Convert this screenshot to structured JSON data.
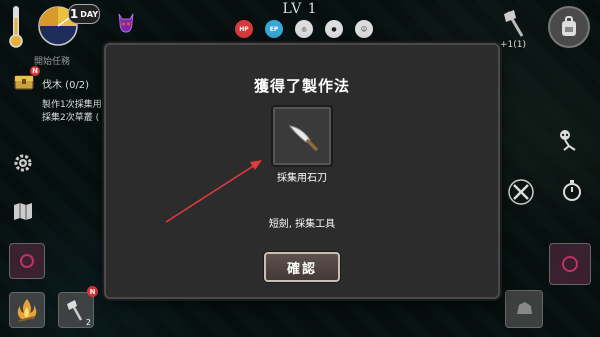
{
  "hud": {
    "day_label": "DAY",
    "day_number": "1",
    "level": "LV 1",
    "stats": [
      {
        "name": "hp",
        "label": "HP"
      },
      {
        "name": "ep",
        "label": "EP"
      },
      {
        "name": "stomach",
        "label": ""
      },
      {
        "name": "water",
        "label": ""
      },
      {
        "name": "mood",
        "label": ""
      }
    ],
    "axe_count": "+1(1)"
  },
  "quest": {
    "header": "開始任務",
    "badge": "N",
    "title": "伐木 (0/2)",
    "lines": [
      "製作1次採集用",
      "採集2次草叢 ("
    ]
  },
  "slots": {
    "axe_count": "2",
    "new_badge": "N"
  },
  "modal": {
    "title": "獲得了製作法",
    "item_name": "採集用石刀",
    "item_desc": "短劍, 採集工具",
    "confirm_label": "確認"
  },
  "colors": {
    "arrow": "#e03a3a",
    "hp": "#d83a3a",
    "ep": "#37a8d8",
    "modal_bg": "#2c2c2c"
  }
}
